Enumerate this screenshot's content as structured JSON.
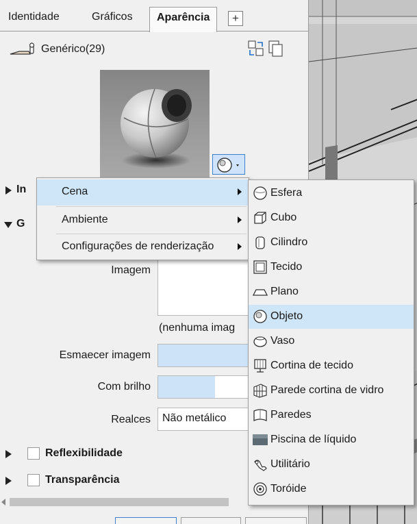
{
  "tabs": {
    "identity": "Identidade",
    "graphics": "Gráficos",
    "appearance": "Aparência",
    "add": "+"
  },
  "asset": {
    "name": "Genérico(29)"
  },
  "sections": {
    "information_partial": "In",
    "generic_partial": "G",
    "reflectivity": "Reflexibilidade",
    "transparency": "Transparência"
  },
  "properties": {
    "image_label": "Imagem",
    "image_none": "(nenhuma imag",
    "fade_label": "Esmaecer imagem",
    "fade_value": 1.0,
    "glossiness_label": "Com brilho",
    "glossiness_value": 0.6,
    "highlights_label": "Realces",
    "highlights_value": "Não metálico"
  },
  "context_menu": {
    "items": [
      {
        "label": "Cena",
        "has_submenu": true,
        "highlighted": true
      },
      {
        "label": "Ambiente",
        "has_submenu": true,
        "highlighted": false
      },
      {
        "label": "Configurações de renderização",
        "has_submenu": true,
        "highlighted": false
      }
    ]
  },
  "scene_submenu": {
    "items": [
      {
        "label": "Esfera",
        "icon": "sphere-icon"
      },
      {
        "label": "Cubo",
        "icon": "cube-icon"
      },
      {
        "label": "Cilindro",
        "icon": "cylinder-icon"
      },
      {
        "label": "Tecido",
        "icon": "fabric-icon"
      },
      {
        "label": "Plano",
        "icon": "plane-icon"
      },
      {
        "label": "Objeto",
        "icon": "object-icon",
        "highlighted": true
      },
      {
        "label": "Vaso",
        "icon": "vase-icon"
      },
      {
        "label": "Cortina de tecido",
        "icon": "fabric-curtain-icon"
      },
      {
        "label": "Parede cortina de vidro",
        "icon": "glass-curtain-wall-icon"
      },
      {
        "label": "Paredes",
        "icon": "walls-icon"
      },
      {
        "label": "Piscina de líquido",
        "icon": "liquid-pool-icon"
      },
      {
        "label": "Utilitário",
        "icon": "utility-icon"
      },
      {
        "label": "Toróide",
        "icon": "torus-icon"
      }
    ]
  },
  "colors": {
    "highlight": "#cfe6f8",
    "accent": "#3f7fd0",
    "panel_bg": "#f0f0f0"
  }
}
